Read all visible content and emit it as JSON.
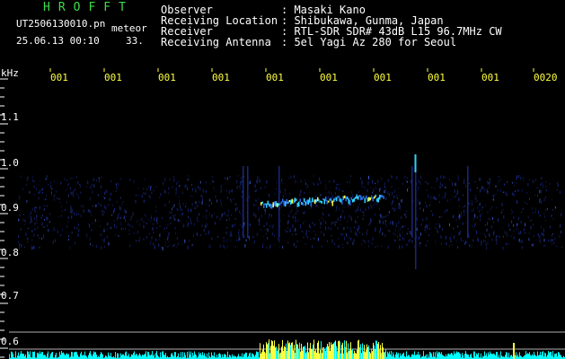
{
  "app": {
    "brand": "HROFFT",
    "filename": "UT2506130010.pn",
    "tag": "meteor",
    "datetime": "25.06.13 00:10",
    "count": "33."
  },
  "info": {
    "observer_label": "Observer",
    "observer_value": ": Masaki Kano",
    "location_label": "Receiving Location",
    "location_value": ": Shibukawa, Gunma, Japan",
    "receiver_label": "Receiver",
    "receiver_value": ": RTL-SDR SDR# 43dB L15 96.7MHz CW",
    "antenna_label": "Receiving Antenna",
    "antenna_value": ": 5el Yagi Az 280 for Seoul"
  },
  "axis": {
    "unit": "kHz",
    "y_labels": [
      "1.1",
      "1.0",
      "0.9",
      "0.8",
      "0.7",
      "0.6"
    ],
    "time_ticks": [
      "001",
      "001",
      "001",
      "001",
      "001",
      "001",
      "001",
      "001",
      "001",
      "0020"
    ]
  },
  "colors": {
    "background": "#000000",
    "brand": "#3ddc4a",
    "tick": "#ffff40",
    "signal_low": "#1a2a8a",
    "signal_mid": "#2fd0ff",
    "signal_high": "#ffff40",
    "baseline": "#00ffff"
  }
}
